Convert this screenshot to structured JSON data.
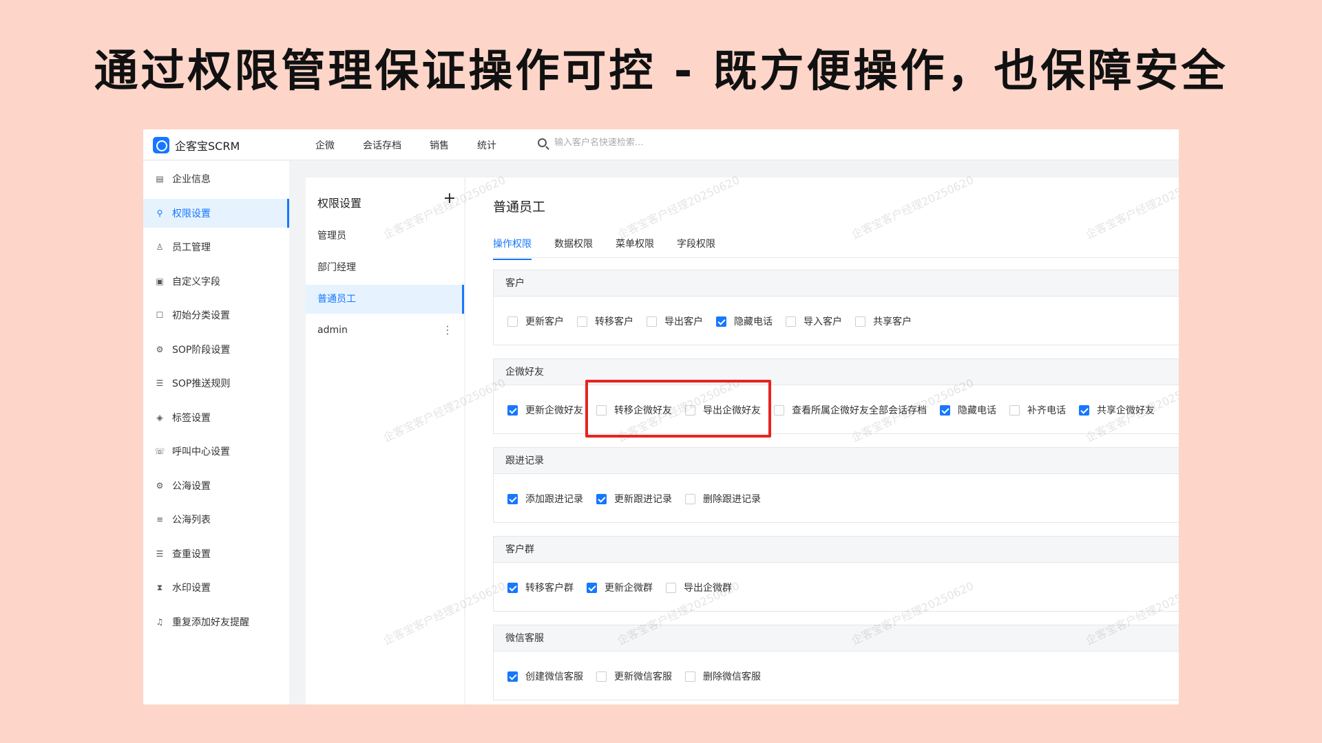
{
  "headline": "通过权限管理保证操作可控 - 既方便操作，也保障安全",
  "app": {
    "name": "企客宝SCRM"
  },
  "topnav": [
    "企微",
    "会话存档",
    "销售",
    "统计"
  ],
  "search": {
    "placeholder": "输入客户名快速检索..."
  },
  "sidebar": {
    "items": [
      {
        "label": "企业信息",
        "icon": "company-icon"
      },
      {
        "label": "权限设置",
        "icon": "key-icon",
        "active": true
      },
      {
        "label": "员工管理",
        "icon": "user-icon"
      },
      {
        "label": "自定义字段",
        "icon": "form-icon"
      },
      {
        "label": "初始分类设置",
        "icon": "square-icon"
      },
      {
        "label": "SOP阶段设置",
        "icon": "stage-icon"
      },
      {
        "label": "SOP推送规则",
        "icon": "list-icon"
      },
      {
        "label": "标签设置",
        "icon": "tag-icon"
      },
      {
        "label": "呼叫中心设置",
        "icon": "phone-icon"
      },
      {
        "label": "公海设置",
        "icon": "gear-icon"
      },
      {
        "label": "公海列表",
        "icon": "list-lines-icon"
      },
      {
        "label": "查重设置",
        "icon": "list-icon"
      },
      {
        "label": "水印设置",
        "icon": "hourglass-icon"
      },
      {
        "label": "重复添加好友提醒",
        "icon": "bell-icon"
      }
    ]
  },
  "rolepanel": {
    "title": "权限设置",
    "add": "+",
    "roles": [
      "管理员",
      "部门经理",
      "普通员工",
      "admin"
    ],
    "active_role": "普通员工",
    "more": "⋮"
  },
  "main": {
    "title": "普通员工",
    "tabs": [
      "操作权限",
      "数据权限",
      "菜单权限",
      "字段权限"
    ],
    "active_tab": "操作权限",
    "sections": [
      {
        "title": "客户",
        "options": [
          {
            "label": "更新客户",
            "checked": false
          },
          {
            "label": "转移客户",
            "checked": false
          },
          {
            "label": "导出客户",
            "checked": false
          },
          {
            "label": "隐藏电话",
            "checked": true
          },
          {
            "label": "导入客户",
            "checked": false
          },
          {
            "label": "共享客户",
            "checked": false
          }
        ]
      },
      {
        "title": "企微好友",
        "options": [
          {
            "label": "更新企微好友",
            "checked": true
          },
          {
            "label": "转移企微好友",
            "checked": false
          },
          {
            "label": "导出企微好友",
            "checked": false
          },
          {
            "label": "查看所属企微好友全部会话存档",
            "checked": false
          },
          {
            "label": "隐藏电话",
            "checked": true
          },
          {
            "label": "补齐电话",
            "checked": false
          },
          {
            "label": "共享企微好友",
            "checked": true
          }
        ]
      },
      {
        "title": "跟进记录",
        "options": [
          {
            "label": "添加跟进记录",
            "checked": true
          },
          {
            "label": "更新跟进记录",
            "checked": true
          },
          {
            "label": "删除跟进记录",
            "checked": false
          }
        ]
      },
      {
        "title": "客户群",
        "options": [
          {
            "label": "转移客户群",
            "checked": true
          },
          {
            "label": "更新企微群",
            "checked": true
          },
          {
            "label": "导出企微群",
            "checked": false
          }
        ]
      },
      {
        "title": "微信客服",
        "options": [
          {
            "label": "创建微信客服",
            "checked": true
          },
          {
            "label": "更新微信客服",
            "checked": false
          },
          {
            "label": "删除微信客服",
            "checked": false
          }
        ]
      }
    ]
  },
  "watermark": "企客宝客户经理20250620",
  "colors": {
    "accent": "#1677ff",
    "highlight": "#e8231f",
    "background": "#fdd5c9"
  }
}
